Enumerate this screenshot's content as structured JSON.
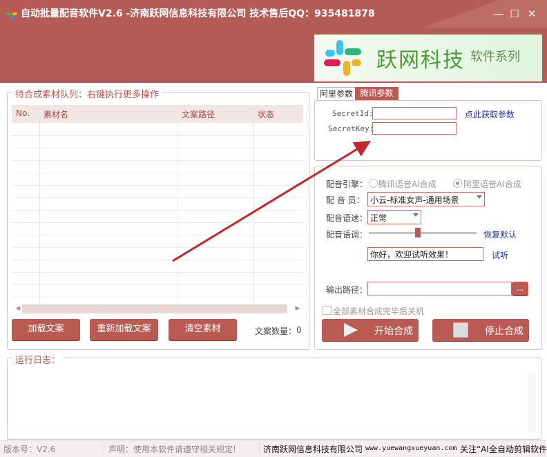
{
  "window": {
    "title": "自动批量配音软件V2.6 -济南跃网信息科技有限公司 技术售后QQ：935481878",
    "minimize": "—",
    "maximize": "☐",
    "close": "✕"
  },
  "banner": {
    "brand": "跃网科技",
    "series": "软件系列"
  },
  "queue": {
    "title": "待合成素材队列：右键执行更多操作",
    "columns": [
      "No.",
      "素材名",
      "文案路径",
      "状态"
    ],
    "rows": []
  },
  "actions": {
    "load": "加载文案",
    "reload": "重新加载文案",
    "clear": "清空素材",
    "count_label": "文案数量：",
    "count_value": "0"
  },
  "tabs": {
    "ali": "阿里参数",
    "tencent": "腾讯参数"
  },
  "credentials": {
    "secret_id_label": "SecretId:",
    "secret_id_value": "",
    "secret_key_label": "SecretKey:",
    "secret_key_value": "",
    "get_params_link": "点此获取参数"
  },
  "voice": {
    "engine_label": "配音引擎：",
    "engine_tencent": "腾讯语音AI合成",
    "engine_ali": "阿里语音AI合成",
    "engine_selected": "ali",
    "voice_label": "配 音 员：",
    "voice_value": "小云-标准女声-通用场景",
    "speed_label": "配音语速：",
    "speed_value": "正常",
    "tone_label": "配音语调：",
    "tone_level": 0.45,
    "restore_default": "恢复默认",
    "preview_text": "你好，欢迎试听效果！",
    "preview_button": "试听"
  },
  "output": {
    "label": "输出路径：",
    "value": "",
    "browse": "..."
  },
  "shutdown": {
    "label": "全部素材合成完毕后关机",
    "checked": false
  },
  "synthesis": {
    "start": "开始合成",
    "stop": "停止合成"
  },
  "log": {
    "title": "运行日志："
  },
  "statusbar": {
    "version": "版本号：V2.6",
    "notice": "声明：使用本软件请遵守相关规定!",
    "company": "济南跃网信息科技有限公司",
    "domain": "www.yuewangxueyuan.com",
    "follow": "关注“AI全自动剪辑软件"
  },
  "colors": {
    "brand_red": "#b95a53",
    "title_bar": "#b55b55",
    "annotation_arrow": "#c0262a"
  }
}
